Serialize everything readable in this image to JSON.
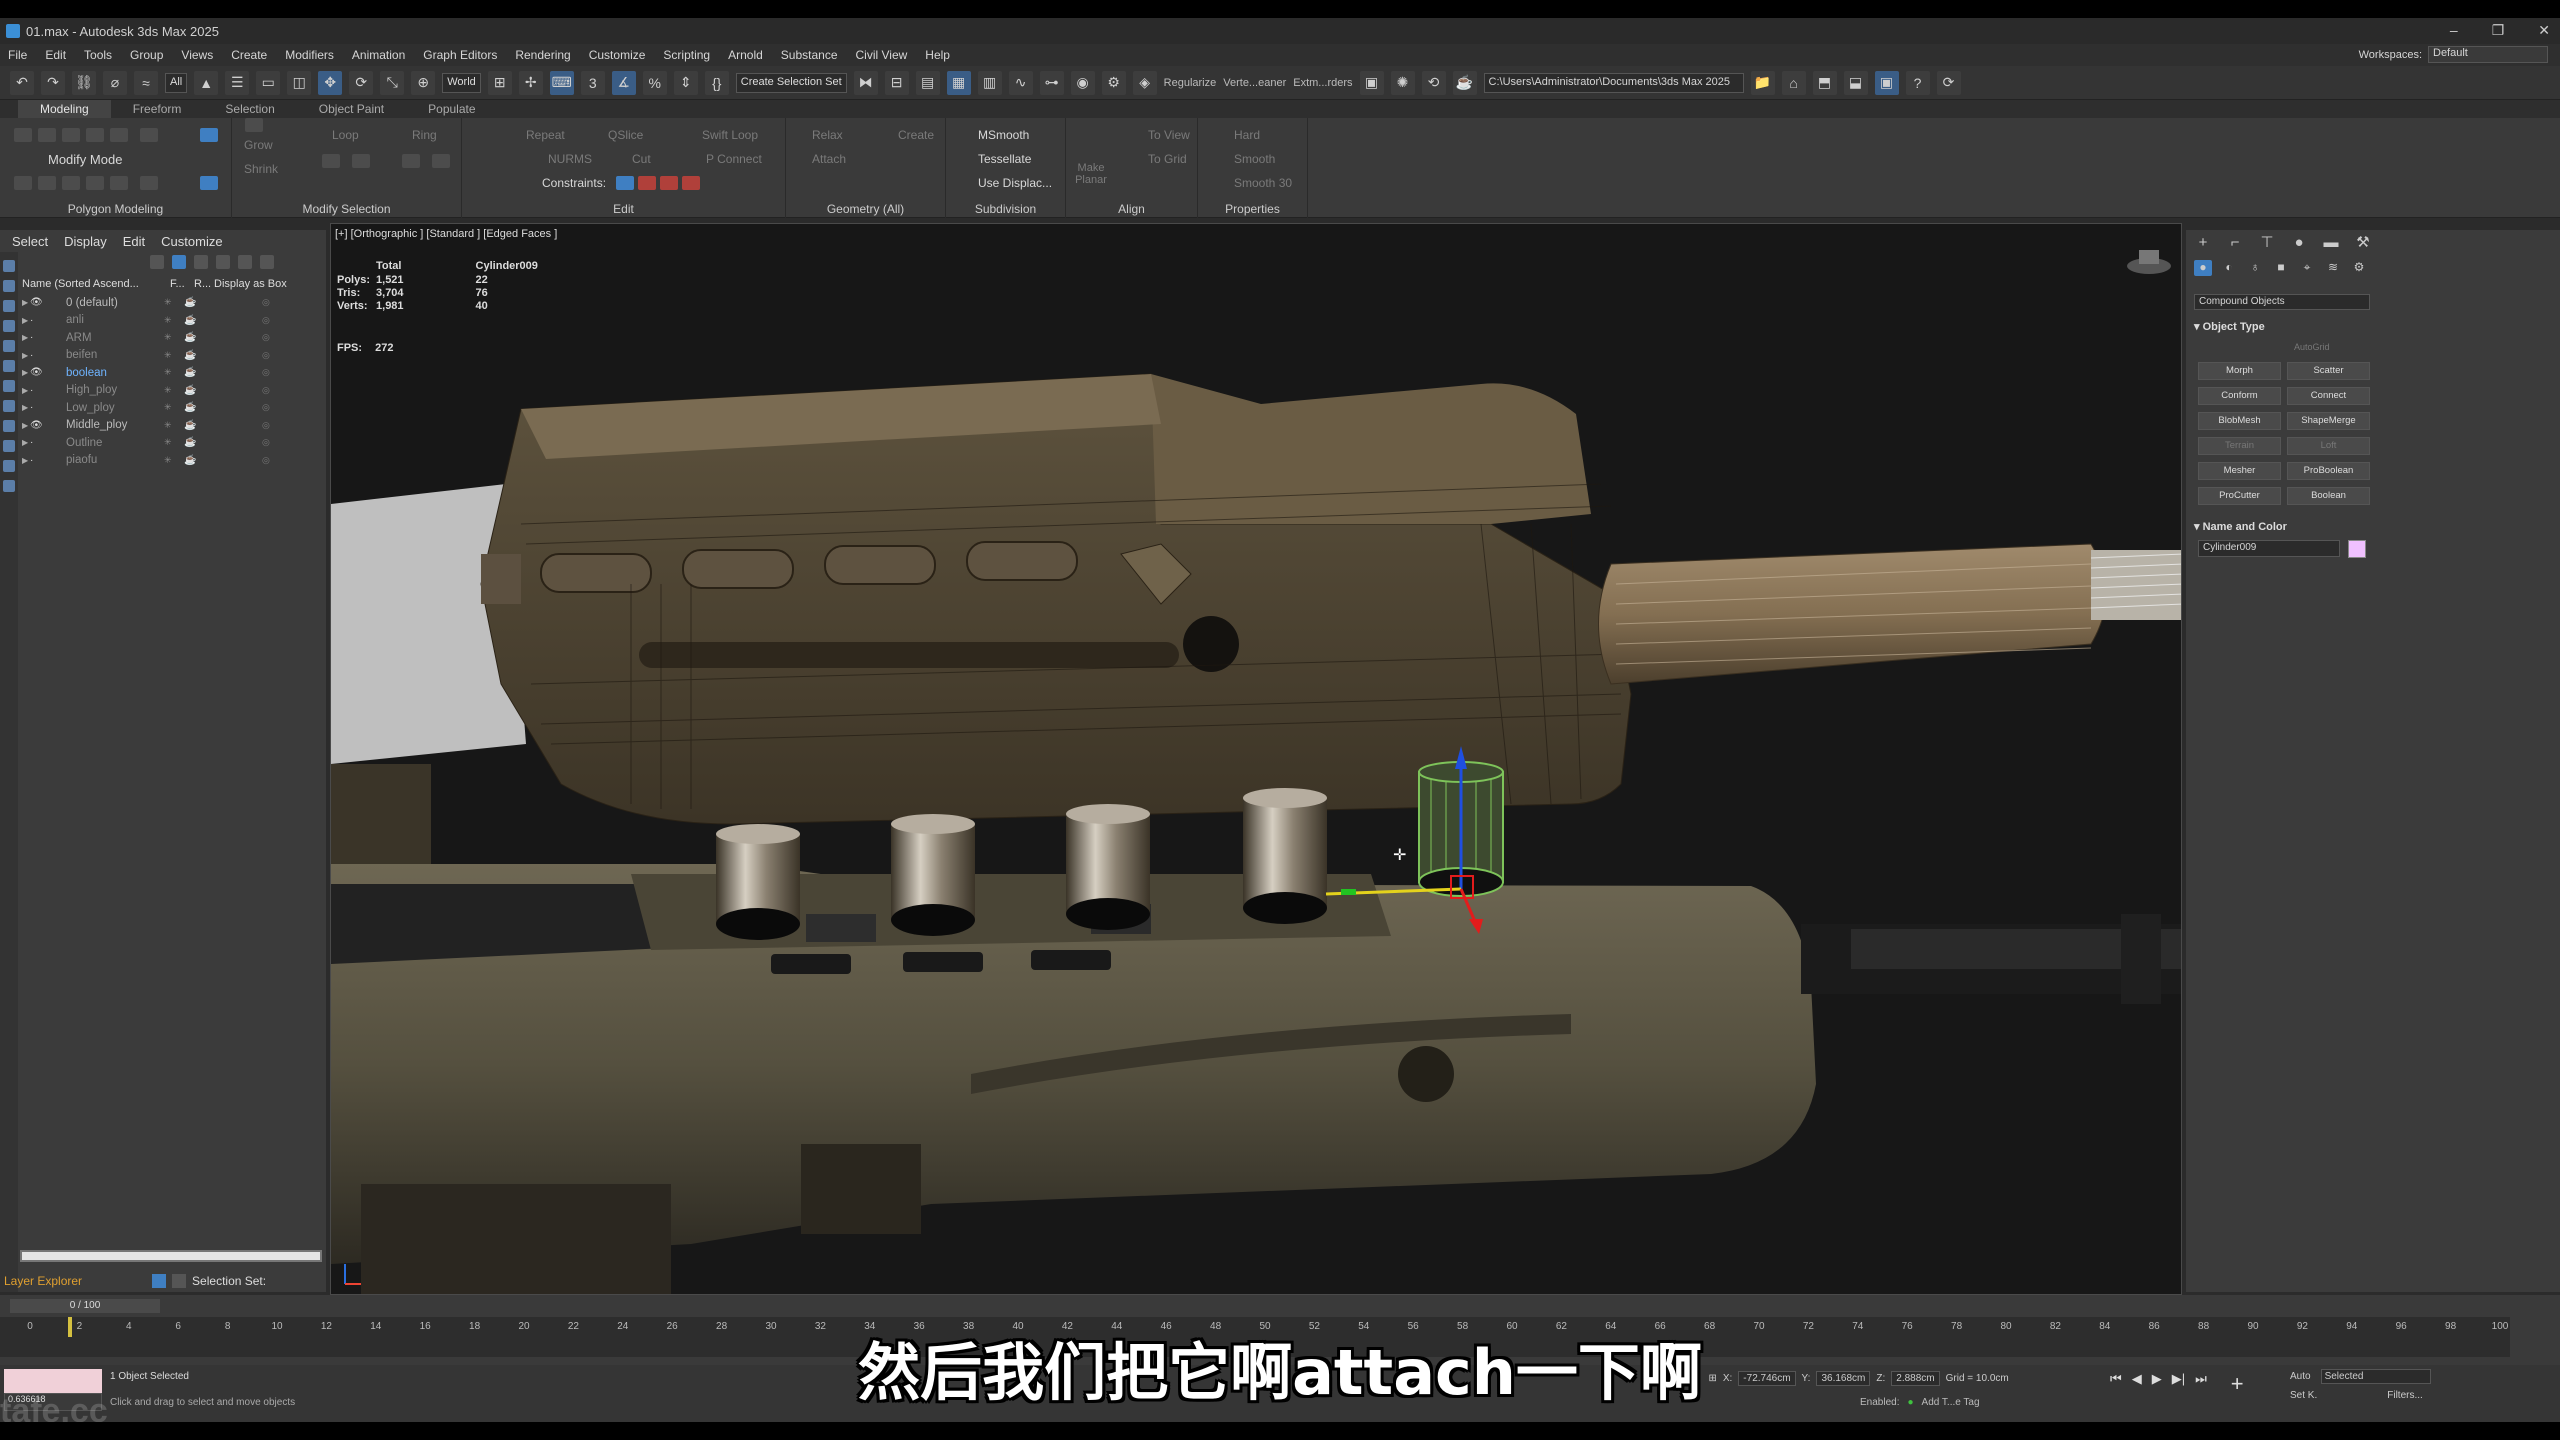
{
  "window": {
    "title": "01.max - Autodesk 3ds Max 2025",
    "controls": [
      "–",
      "❐",
      "✕"
    ]
  },
  "menu": [
    "File",
    "Edit",
    "Tools",
    "Group",
    "Views",
    "Create",
    "Modifiers",
    "Animation",
    "Graph Editors",
    "Rendering",
    "Customize",
    "Scripting",
    "Arnold",
    "Substance",
    "Civil View",
    "Help"
  ],
  "workspace": {
    "label": "Workspaces:",
    "value": "Default"
  },
  "toolbar": {
    "filter": "All",
    "coord": "World",
    "selection_set": "Create Selection Set",
    "regularize": "Regularize",
    "vert_cleaner": "Verte...eaner",
    "extm_rders": "Extm...rders",
    "path": "C:\\Users\\Administrator\\Documents\\3ds Max 2025"
  },
  "ribbon_tabs": [
    "Modeling",
    "Freeform",
    "Selection",
    "Object Paint",
    "Populate"
  ],
  "ribbon": {
    "modify_mode": "Modify Mode",
    "polygon_modeling": "Polygon Modeling",
    "modify_selection": "Modify Selection",
    "grow": "Grow",
    "shrink": "Shrink",
    "loop": "Loop",
    "ring": "Ring",
    "repeat": "Repeat",
    "qslice": "QSlice",
    "swift_loop": "Swift Loop",
    "nurms": "NURMS",
    "cut": "Cut",
    "p_connect": "P Connect",
    "constraints": "Constraints:",
    "edit": "Edit",
    "relax": "Relax",
    "create": "Create",
    "attach": "Attach",
    "geometry_all": "Geometry (All)",
    "msmooth": "MSmooth",
    "tessellate": "Tessellate",
    "use_displac": "Use Displac...",
    "subdivision": "Subdivision",
    "make_planar": "Make Planar",
    "to_view": "To View",
    "to_grid": "To Grid",
    "align": "Align",
    "hard": "Hard",
    "smooth": "Smooth",
    "smooth30": "Smooth 30",
    "properties": "Properties"
  },
  "scene_explorer": {
    "menu": [
      "Select",
      "Display",
      "Edit",
      "Customize"
    ],
    "columns": [
      "Name (Sorted Ascend...",
      "F...",
      "R...",
      "Display as Box"
    ],
    "rows": [
      {
        "name": "0 (default)",
        "bright": true,
        "highlight": false
      },
      {
        "name": "anli",
        "bright": false,
        "highlight": false
      },
      {
        "name": "ARM",
        "bright": false,
        "highlight": false
      },
      {
        "name": "beifen",
        "bright": false,
        "highlight": false
      },
      {
        "name": "boolean",
        "bright": true,
        "highlight": true
      },
      {
        "name": "High_ploy",
        "bright": false,
        "highlight": false
      },
      {
        "name": "Low_ploy",
        "bright": false,
        "highlight": false
      },
      {
        "name": "Middle_ploy",
        "bright": true,
        "highlight": false
      },
      {
        "name": "Outline",
        "bright": false,
        "highlight": false
      },
      {
        "name": "piaofu",
        "bright": false,
        "highlight": false
      }
    ],
    "footer_label": "Layer Explorer",
    "selection_set_label": "Selection Set:"
  },
  "viewport": {
    "label": "[+] [Orthographic ] [Standard ] [Edged Faces ]",
    "stats": {
      "col_total": "Total",
      "col_object": "Cylinder009",
      "rows": [
        {
          "k": "Polys:",
          "total": "1,521",
          "obj": "22"
        },
        {
          "k": "Tris:",
          "total": "3,704",
          "obj": "76"
        },
        {
          "k": "Verts:",
          "total": "1,981",
          "obj": "40"
        }
      ],
      "fps_label": "FPS:",
      "fps": "272"
    }
  },
  "command_panel": {
    "dropdown": "Compound Objects",
    "object_type": "Object Type",
    "autogrid": "AutoGrid",
    "buttons": [
      {
        "label": "Morph",
        "enabled": true
      },
      {
        "label": "Scatter",
        "enabled": true
      },
      {
        "label": "Conform",
        "enabled": true
      },
      {
        "label": "Connect",
        "enabled": true
      },
      {
        "label": "BlobMesh",
        "enabled": true
      },
      {
        "label": "ShapeMerge",
        "enabled": true
      },
      {
        "label": "Terrain",
        "enabled": false
      },
      {
        "label": "Loft",
        "enabled": false
      },
      {
        "label": "Mesher",
        "enabled": true
      },
      {
        "label": "ProBoolean",
        "enabled": true
      },
      {
        "label": "ProCutter",
        "enabled": true
      },
      {
        "label": "Boolean",
        "enabled": true
      }
    ],
    "name_and_color": "Name and Color",
    "object_name": "Cylinder009",
    "object_color": "#f0c0ff"
  },
  "timeline": {
    "frame": "0 / 100",
    "ticks": [
      "0",
      "2",
      "4",
      "6",
      "8",
      "10",
      "12",
      "14",
      "16",
      "18",
      "20",
      "22",
      "24",
      "26",
      "28",
      "30",
      "32",
      "34",
      "36",
      "38",
      "40",
      "42",
      "44",
      "46",
      "48",
      "50",
      "52",
      "54",
      "56",
      "58",
      "60",
      "62",
      "64",
      "66",
      "68",
      "70",
      "72",
      "74",
      "76",
      "78",
      "80",
      "82",
      "84",
      "86",
      "88",
      "90",
      "92",
      "94",
      "96",
      "98",
      "100"
    ]
  },
  "status": {
    "maxscript_value": "0.636618",
    "selected": "1 Object Selected",
    "hint": "Click and drag to select and move objects",
    "x_label": "X:",
    "x": "-72.746cm",
    "y_label": "Y:",
    "y": "36.168cm",
    "z_label": "Z:",
    "z": "2.888cm",
    "grid": "Grid = 10.0cm",
    "enabled": "Enabled:",
    "add_tag": "Add T...e Tag",
    "auto": "Auto",
    "set_k": "Set K.",
    "selected_dd": "Selected",
    "filters": "Filters...",
    "frame_field": "0"
  },
  "subtitle": "然后我们把它啊attach一下啊",
  "watermark": "tafe.cc"
}
